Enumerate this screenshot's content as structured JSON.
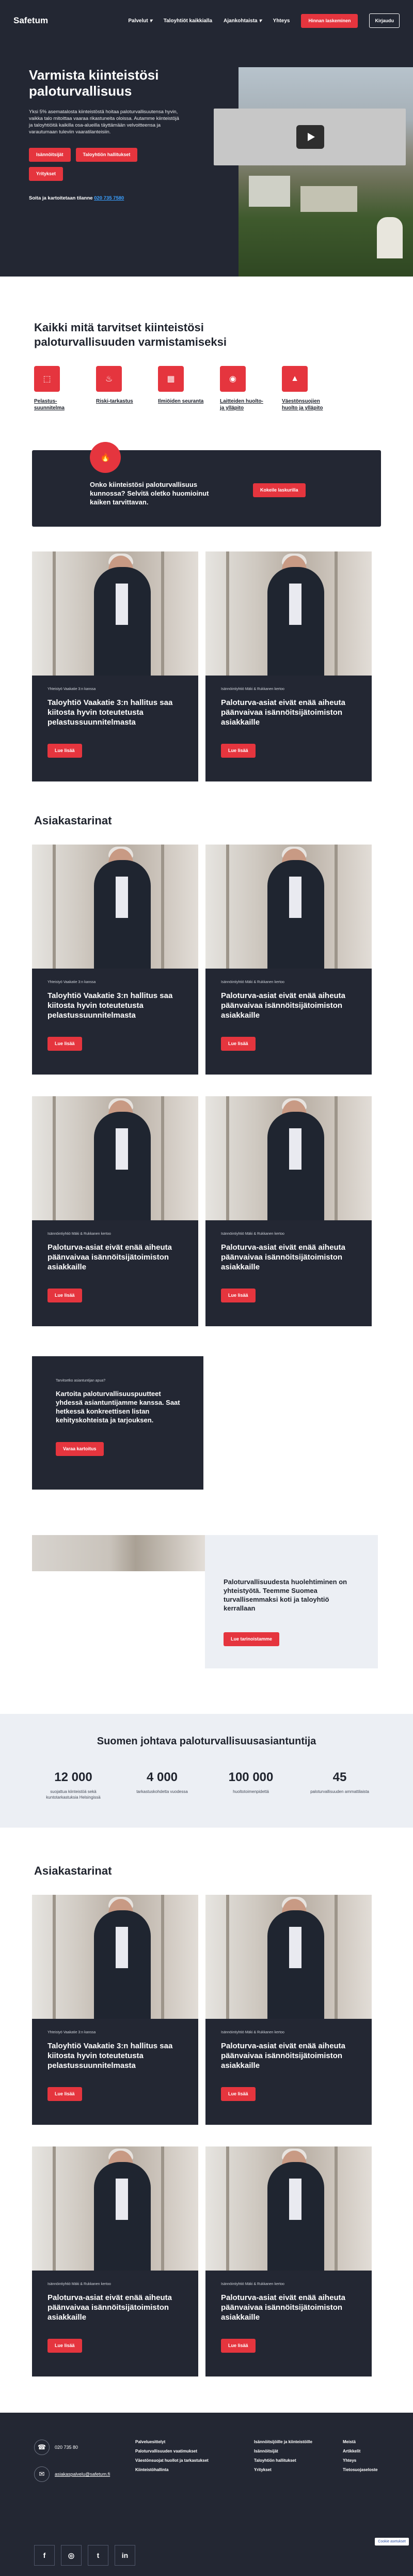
{
  "nav": {
    "logo": "Safetum",
    "items": [
      "Palvelut",
      "Taloyhtiöt kaikkialla",
      "Ajankohtaista",
      "Yhteys"
    ],
    "cta": "Hinnan laskeminen",
    "login": "Kirjaudu"
  },
  "hero": {
    "title": "Varmista kiinteistösi paloturvallisuus",
    "text": "Yksi 5% asematalosta kiinteistöstä hoitaa paloturvallisuutensa hyvin, vaikka talo mitoittaa vaaraa rikastuneita oloissa. Autamme kiinteistöjä ja taloyhtiöitä kaikilla osa-alueilla täyttämään velvoitteensa ja varautumaan tuleviin vaaratilanteisiin.",
    "buttons": [
      "Isännöitsijät",
      "Taloyhtiön hallitukset",
      "Yritykset"
    ],
    "call": "Soita ja kartoitetaan tilanne",
    "phone": "020 735 7580"
  },
  "services": {
    "title": "Kaikki mitä tarvitset kiinteistösi paloturvallisuuden varmistamiseksi",
    "items": [
      {
        "label": "Pelastus-suunnitelma",
        "icon": "exit-sign-icon"
      },
      {
        "label": "Riski-tarkastus",
        "icon": "fire-icon"
      },
      {
        "label": "Ilmiöiden seuranta",
        "icon": "building-icon"
      },
      {
        "label": "Laitteiden huolto- ja ylläpito",
        "icon": "extinguisher-icon"
      },
      {
        "label": "Väestönsuojien huolto ja ylläpito",
        "icon": "warning-icon"
      }
    ]
  },
  "cta_box": {
    "text": "Onko kiinteistösi paloturvallisuus kunnossa? Selvitä oletko huomioinut kaiken tarvittavan.",
    "button": "Kokeile laskurilla"
  },
  "cards": [
    {
      "meta": "Yhteistyö Vaakatie 3:n kanssa",
      "title": "Taloyhtiö Vaakatie 3:n hallitus saa kiitosta hyvin toteutetusta pelastussuunnitelmasta",
      "button": "Lue lisää"
    },
    {
      "meta": "Isännöintiyhtiö Mäki & Rukkanen kertoo",
      "title": "Paloturva-asiat eivät enää aiheuta päänvaivaa isännöitsijätoimiston asiakkaille",
      "button": "Lue lisää"
    }
  ],
  "case_title": "Asiakastarinat",
  "text_card": {
    "meta": "Tarvitsetko asiantuntijan apua?",
    "title": "Kartoita paloturvallisuuspuutteet yhdessä asiantuntijamme kanssa. Saat hetkessä konkreettisen listan kehityskohteista ja tarjouksen.",
    "button": "Varaa kartoitus"
  },
  "split": {
    "text": "Paloturvallisuudesta huolehtiminen on yhteistyötä. Teemme Suomea turvallisemmaksi koti ja taloyhtiö kerrallaan",
    "button": "Lue tarinoistamme"
  },
  "stats": {
    "title": "Suomen johtava paloturvallisuusasiantuntija",
    "items": [
      {
        "n": "12 000",
        "d": "suojattua kiinteistöä sekä kuntotarkastuksia Helsingissä"
      },
      {
        "n": "4 000",
        "d": "tarkastuskohdetta vuodessa"
      },
      {
        "n": "100 000",
        "d": "huoltotoimenpidettä"
      },
      {
        "n": "45",
        "d": "paloturvallisuuden ammattilaista"
      }
    ]
  },
  "footer": {
    "phone": "020 735 80",
    "email": "asiakaspalvelu@safetum.fi",
    "col1": [
      "Palveluesittelyt",
      "Paloturvallisuuden vaatimukset",
      "Väestönsuojat huollot ja tarkastukset",
      "Kiinteistöhallinta"
    ],
    "col2": [
      "Isännöitsijöille ja kiinteistöille",
      "Isännöitsijät",
      "Taloyhtiön hallitukset",
      "Yritykset"
    ],
    "col3": [
      "Meistä",
      "Artikkelit",
      "Yhteys",
      "Tietosuojaseloste"
    ],
    "socials": [
      "f",
      "◎",
      "t",
      "in"
    ],
    "badge": "Cookie asetukset"
  }
}
